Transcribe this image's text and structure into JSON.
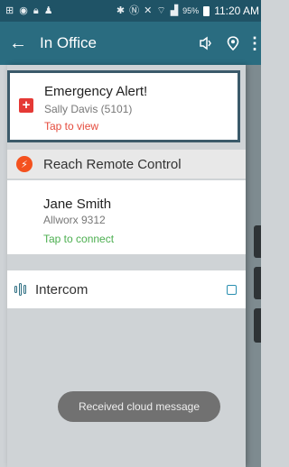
{
  "status_bar": {
    "battery_percent": "95%",
    "time": "11:20 AM",
    "icons": [
      "notification-icon",
      "app-icon",
      "lock-icon",
      "person-icon",
      "bluetooth-icon",
      "nfc-icon",
      "mute-icon",
      "wifi-icon",
      "signal-icon",
      "battery-icon"
    ]
  },
  "app_bar": {
    "title": "In Office",
    "back_icon": "arrow-left-icon",
    "actions": [
      "speaker-icon",
      "location-pin-icon",
      "more-vert-icon"
    ]
  },
  "alert": {
    "title": "Emergency Alert!",
    "subtitle": "Sally Davis (5101)",
    "link": "Tap to view",
    "icon": "medical-cross-icon",
    "accent_color": "#e53935"
  },
  "reach_section": {
    "label": "Reach Remote Control",
    "icon": "bolt-icon",
    "icon_color": "#f4511e"
  },
  "contact": {
    "name": "Jane Smith",
    "subtitle": "Allworx 9312",
    "link": "Tap to connect",
    "link_color": "#4caf50"
  },
  "intercom": {
    "label": "Intercom",
    "icon": "intercom-icon",
    "checked": false
  },
  "toast": {
    "message": "Received cloud message"
  },
  "colors": {
    "status_bar": "#1f5366",
    "app_bar": "#2a6c80"
  }
}
